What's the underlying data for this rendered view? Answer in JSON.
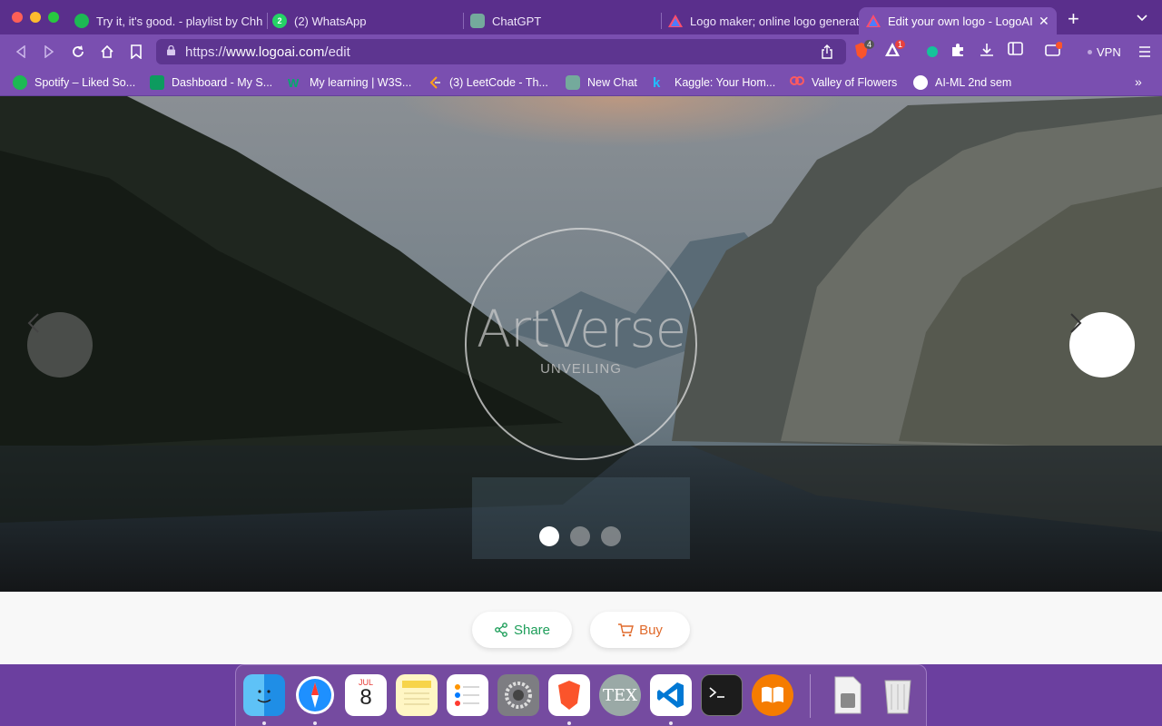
{
  "browser": {
    "tabs": [
      {
        "label": "Try it, it's good. - playlist by Chh",
        "active": false
      },
      {
        "label": "(2) WhatsApp",
        "active": false
      },
      {
        "label": "ChatGPT",
        "active": false
      },
      {
        "label": "Logo maker; online logo generat",
        "active": false
      },
      {
        "label": "Edit your own logo - LogoAI",
        "active": true
      }
    ],
    "new_tab": "+",
    "url": {
      "scheme": "https://",
      "host": "www.logoai.com",
      "path": "/edit"
    },
    "brave_badge": "4",
    "rewards_badge": "1",
    "vpn_label": "VPN",
    "bookmarks": [
      {
        "label": "Spotify – Liked So..."
      },
      {
        "label": "Dashboard - My S..."
      },
      {
        "label": "My learning | W3S..."
      },
      {
        "label": "(3) LeetCode - Th..."
      },
      {
        "label": "New Chat"
      },
      {
        "label": "Kaggle: Your Hom..."
      },
      {
        "label": "Valley of Flowers"
      },
      {
        "label": "AI-ML 2nd sem"
      }
    ],
    "bookmarks_more": "»"
  },
  "preview": {
    "logo_title": "ArtVerse",
    "logo_subtitle": "UNVEILING",
    "slides_total": 3,
    "active_slide": 1
  },
  "actions": {
    "share_label": "Share",
    "buy_label": "Buy"
  },
  "dock": {
    "calendar_month": "JUL",
    "calendar_day": "8",
    "apps": [
      "finder-icon",
      "safari-icon",
      "calendar-icon",
      "notes-icon",
      "reminders-icon",
      "system-preferences-icon",
      "brave-icon",
      "tex-icon",
      "vscode-icon",
      "terminal-icon",
      "books-icon",
      "downloads-icon",
      "trash-icon"
    ],
    "tex_label": "TEX"
  },
  "colors": {
    "browser_purple": "#7a4fb0",
    "share_green": "#1e9e5a",
    "buy_orange": "#e06a2b"
  }
}
